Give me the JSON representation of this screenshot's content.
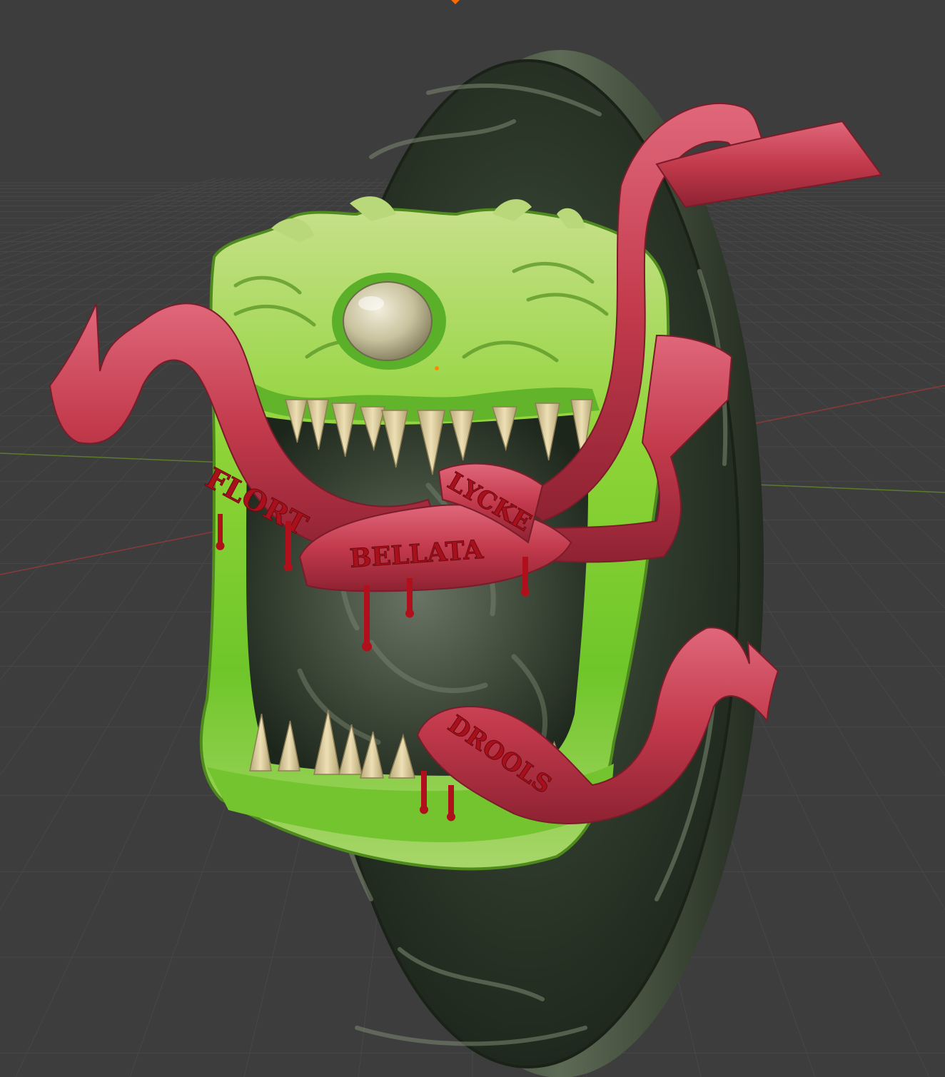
{
  "viewport": {
    "background_color": "#3d3d3d",
    "grid_color": "#474747",
    "x_axis_color": "#8a3a3a",
    "y_axis_color": "#5c7a2e",
    "origin_marker_color": "#ff6a00"
  },
  "scene": {
    "model": "cyclops-monster-plaque",
    "base_color": "#2f3a2c",
    "face_color": "#7ccf2e",
    "teeth_color": "#dccb9a",
    "eye_color": "#cfc8a8",
    "ribbon_color": "#c23a4c",
    "ribbon_lettering": [
      "FLORT",
      "BELLATA",
      "LYCKE",
      "DROOLS"
    ],
    "blood_color": "#b0101c"
  }
}
